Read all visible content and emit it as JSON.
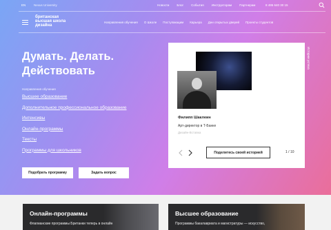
{
  "topbar": {
    "lang": "EN",
    "university": "Nexus University",
    "links": [
      "Новости",
      "Блог",
      "События",
      "Инструкторам",
      "Партнерам"
    ],
    "phone": "8 495 640 30 15"
  },
  "logo": {
    "line1": "британская",
    "line2": "высшая школа",
    "line3": "дизайна"
  },
  "nav": [
    "Направления обучения",
    "О Школе",
    "Поступающим",
    "Карьера",
    "Дни открытых дверей",
    "Проекты студентов"
  ],
  "hero": {
    "headline_line1": "Думать. Делать.",
    "headline_line2": "Действовать",
    "directions_label": "Направления обучения",
    "directions": [
      "Высшее образование",
      "Дополнительное профессиональное образование",
      "Интенсивы",
      "Онлайн-программы",
      "Тексты",
      "Программы для школьников"
    ],
    "btn_pick": "Подобрать программу",
    "btn_ask": "Задать вопрос"
  },
  "story": {
    "name": "Филипп Шаклеин",
    "role": "Арт-директор в Т-Банке",
    "course": "Дизайн-Вставка",
    "share_label": "Поделитесь своей историей",
    "pager": "1 / 10",
    "side_label": "Истории успеха"
  },
  "tiles": [
    {
      "title": "Онлайн-программы",
      "desc": "Флагманские программы Британки теперь в онлайн"
    },
    {
      "title": "Высшее образование",
      "desc": "Программы бакалавриата и магистратуры — искусство,"
    }
  ],
  "colors": {
    "gradient_start": "#7aa6f5",
    "gradient_mid": "#d07ee8",
    "gradient_end": "#ea6e9a",
    "tile_bg": "#2a2a2c"
  }
}
